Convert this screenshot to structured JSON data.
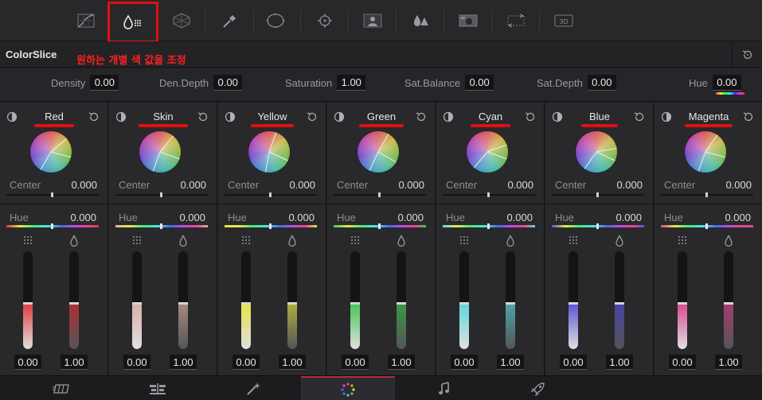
{
  "toolbar": {
    "tools": [
      {
        "name": "curves-icon",
        "active": false
      },
      {
        "name": "colorslice-icon",
        "active": true
      },
      {
        "name": "color-warper-icon",
        "active": false
      },
      {
        "name": "qualifier-eyedropper-icon",
        "active": false
      },
      {
        "name": "window-icon",
        "active": false
      },
      {
        "name": "tracker-icon",
        "active": false
      },
      {
        "name": "magic-mask-icon",
        "active": false
      },
      {
        "name": "blur-icon",
        "active": false
      },
      {
        "name": "key-icon",
        "active": false
      },
      {
        "name": "sizing-icon",
        "active": false
      },
      {
        "name": "3d-icon",
        "active": false,
        "label": "3D"
      }
    ]
  },
  "panel": {
    "title": "ColorSlice",
    "annotation": "원하는 개별 색 값을 조정"
  },
  "globals": [
    {
      "label": "Density",
      "value": "0.00"
    },
    {
      "label": "Den.Depth",
      "value": "0.00"
    },
    {
      "label": "Saturation",
      "value": "1.00"
    },
    {
      "label": "Sat.Balance",
      "value": "0.00"
    },
    {
      "label": "Sat.Depth",
      "value": "0.00"
    },
    {
      "label": "Hue",
      "value": "0.00"
    }
  ],
  "columns": [
    {
      "name": "Red",
      "center_label": "Center",
      "center": "0.000",
      "hue_label": "Hue",
      "hue": "0.000",
      "saturation": "0.00",
      "density": "1.00",
      "color": "#e0393d",
      "sat_level": 0.47,
      "den_level": 0.47
    },
    {
      "name": "Skin",
      "center_label": "Center",
      "center": "0.000",
      "hue_label": "Hue",
      "hue": "0.000",
      "saturation": "0.00",
      "density": "1.00",
      "color": "#d9b1a4",
      "sat_level": 0.47,
      "den_level": 0.47
    },
    {
      "name": "Yellow",
      "center_label": "Center",
      "center": "0.000",
      "hue_label": "Hue",
      "hue": "0.000",
      "saturation": "0.00",
      "density": "1.00",
      "color": "#e4e24a",
      "sat_level": 0.47,
      "den_level": 0.47
    },
    {
      "name": "Green",
      "center_label": "Center",
      "center": "0.000",
      "hue_label": "Hue",
      "hue": "0.000",
      "saturation": "0.00",
      "density": "1.00",
      "color": "#44c554",
      "sat_level": 0.47,
      "den_level": 0.47
    },
    {
      "name": "Cyan",
      "center_label": "Center",
      "center": "0.000",
      "hue_label": "Hue",
      "hue": "0.000",
      "saturation": "0.00",
      "density": "1.00",
      "color": "#5fd7dc",
      "sat_level": 0.47,
      "den_level": 0.47
    },
    {
      "name": "Blue",
      "center_label": "Center",
      "center": "0.000",
      "hue_label": "Hue",
      "hue": "0.000",
      "saturation": "0.00",
      "density": "1.00",
      "color": "#5a52d6",
      "sat_level": 0.47,
      "den_level": 0.47
    },
    {
      "name": "Magenta",
      "center_label": "Center",
      "center": "0.000",
      "hue_label": "Hue",
      "hue": "0.000",
      "saturation": "0.00",
      "density": "1.00",
      "color": "#d8488e",
      "sat_level": 0.47,
      "den_level": 0.47
    }
  ],
  "pages": [
    {
      "name": "page-media-icon",
      "active": false
    },
    {
      "name": "page-edit-icon",
      "active": false
    },
    {
      "name": "page-fusion-icon",
      "active": false
    },
    {
      "name": "page-color-icon",
      "active": true
    },
    {
      "name": "page-fairlight-icon",
      "active": false
    },
    {
      "name": "page-deliver-icon",
      "active": false
    }
  ],
  "colors": {
    "highlight": "#e01010",
    "active_page": "#b0303c"
  }
}
